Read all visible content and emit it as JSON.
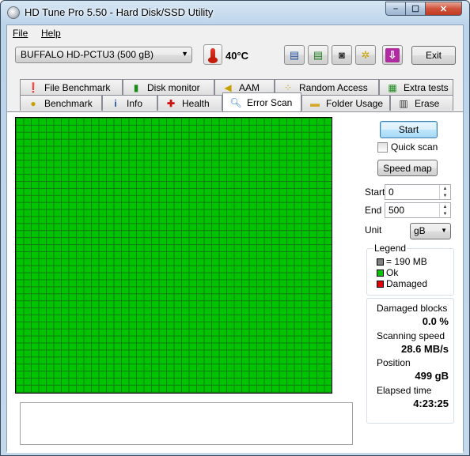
{
  "window": {
    "title": "HD Tune Pro 5.50 - Hard Disk/SSD Utility"
  },
  "menu": {
    "file": "File",
    "help": "Help"
  },
  "toolbar": {
    "drive": "BUFFALO HD-PCTU3 (500 gB)",
    "temperature": "40°C",
    "exit_label": "Exit"
  },
  "tabs_top": [
    {
      "label": "File Benchmark",
      "icon": "file-benchmark-icon"
    },
    {
      "label": "Disk monitor",
      "icon": "disk-monitor-icon"
    },
    {
      "label": "AAM",
      "icon": "speaker-icon"
    },
    {
      "label": "Random Access",
      "icon": "random-access-icon"
    },
    {
      "label": "Extra tests",
      "icon": "extra-tests-icon"
    }
  ],
  "tabs_bottom": [
    {
      "label": "Benchmark",
      "icon": "benchmark-icon"
    },
    {
      "label": "Info",
      "icon": "info-icon"
    },
    {
      "label": "Health",
      "icon": "health-icon"
    },
    {
      "label": "Error Scan",
      "icon": "magnifier-icon",
      "active": true
    },
    {
      "label": "Folder Usage",
      "icon": "folder-icon"
    },
    {
      "label": "Erase",
      "icon": "trash-icon"
    }
  ],
  "error_scan": {
    "start_button": "Start",
    "quick_scan_label": "Quick scan",
    "quick_scan_checked": false,
    "speed_map_button": "Speed map",
    "start_label": "Start",
    "start_value": "0",
    "end_label": "End",
    "end_value": "500",
    "unit_label": "Unit",
    "unit_value": "gB",
    "legend": {
      "title": "Legend",
      "block_size": "= 190 MB",
      "ok": "Ok",
      "damaged": "Damaged"
    },
    "stats": {
      "damaged_blocks_label": "Damaged blocks",
      "damaged_blocks_value": "0.0 %",
      "scanning_speed_label": "Scanning speed",
      "scanning_speed_value": "28.6 MB/s",
      "position_label": "Position",
      "position_value": "499 gB",
      "elapsed_label": "Elapsed time",
      "elapsed_value": "4:23:25"
    }
  },
  "colors": {
    "ok": "#00c400",
    "damaged": "#e00000",
    "block": "#808080"
  }
}
